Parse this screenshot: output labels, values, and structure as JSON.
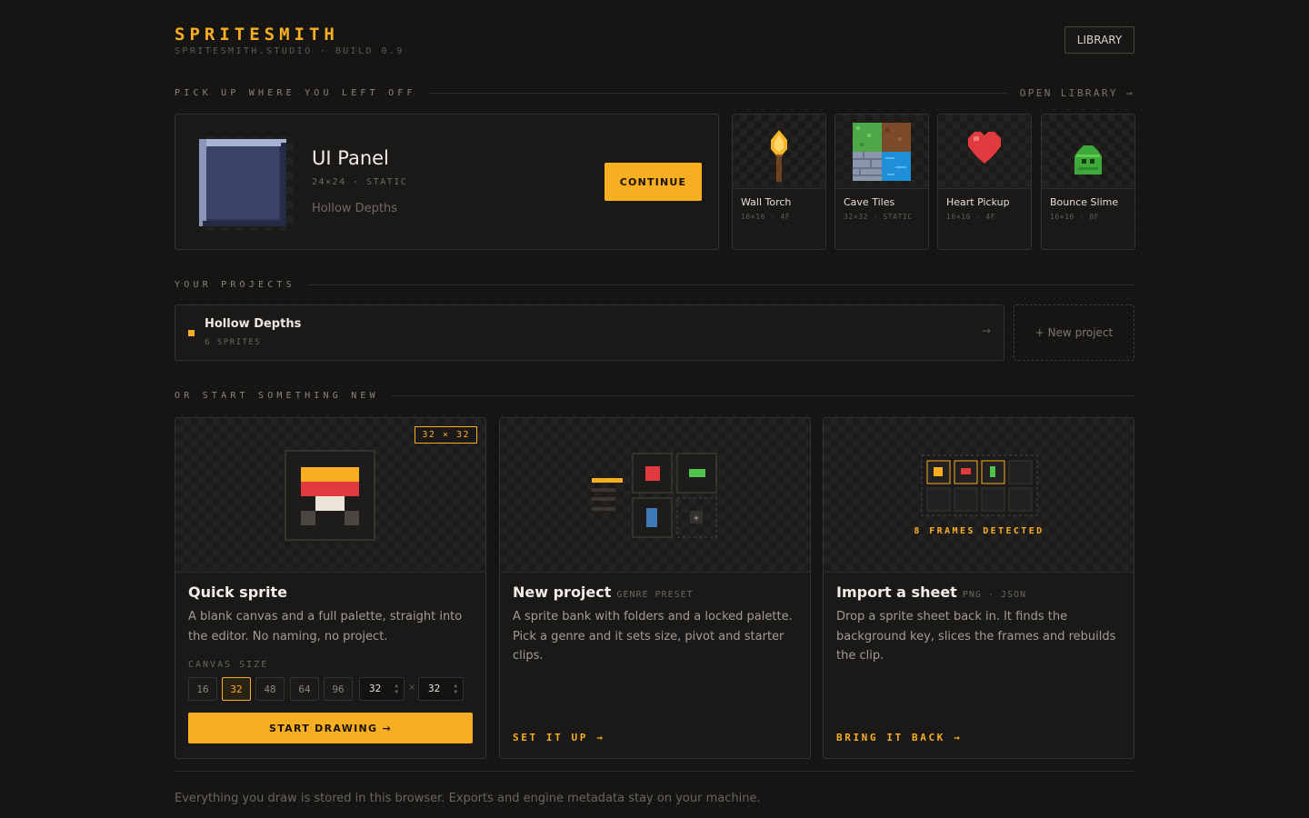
{
  "header": {
    "logo": "SPRITESMITH",
    "subtitle": "SPRITESMITH.STUDIO · BUILD 0.9",
    "library_button": "LIBRARY"
  },
  "recent_section": {
    "heading": "PICK UP WHERE YOU LEFT OFF",
    "link": "OPEN LIBRARY →"
  },
  "recent": {
    "title": "UI Panel",
    "meta": "24×24 · STATIC",
    "project": "Hollow Depths",
    "continue_label": "CONTINUE"
  },
  "recent_tiles": [
    {
      "name": "Wall Torch",
      "meta": "16×16 · 4F",
      "icon": "torch-icon"
    },
    {
      "name": "Cave Tiles",
      "meta": "32×32 · STATIC",
      "icon": "tiles-icon"
    },
    {
      "name": "Heart Pickup",
      "meta": "16×16 · 4F",
      "icon": "heart-icon"
    },
    {
      "name": "Bounce Slime",
      "meta": "16×16 · 8F",
      "icon": "slime-icon"
    }
  ],
  "projects_section": {
    "heading": "YOUR PROJECTS"
  },
  "projects": [
    {
      "name": "Hollow Depths",
      "count": "6 SPRITES"
    }
  ],
  "new_project_label": "+ New project",
  "start_section": {
    "heading": "OR START SOMETHING NEW"
  },
  "quick_sprite": {
    "title": "Quick sprite",
    "size_badge": "32 × 32",
    "description": "A blank canvas and a full palette, straight into the editor. No naming, no project.",
    "canvas_label": "CANVAS SIZE",
    "sizes": [
      "16",
      "32",
      "48",
      "64",
      "96"
    ],
    "selected_size": "32",
    "width_value": "32",
    "height_value": "32",
    "times": "×",
    "start_label": "START DRAWING →"
  },
  "new_project_card": {
    "title": "New project",
    "tag": "GENRE PRESET",
    "description": "A sprite bank with folders and a locked palette. Pick a genre and it sets size, pivot and starter clips.",
    "link": "SET IT UP →",
    "plus": "+"
  },
  "import_card": {
    "title": "Import a sheet",
    "tag": "PNG · JSON",
    "description": "Drop a sprite sheet back in. It finds the background key, slices the frames and rebuilds the clip.",
    "frames_detected": "8 FRAMES DETECTED",
    "link": "BRING IT BACK →"
  },
  "footer": "Everything you draw is stored in this browser. Exports and engine metadata stay on your machine.",
  "colors": {
    "accent": "#f7ae22",
    "background": "#161514",
    "card": "#1a1918",
    "border": "#34322e"
  }
}
